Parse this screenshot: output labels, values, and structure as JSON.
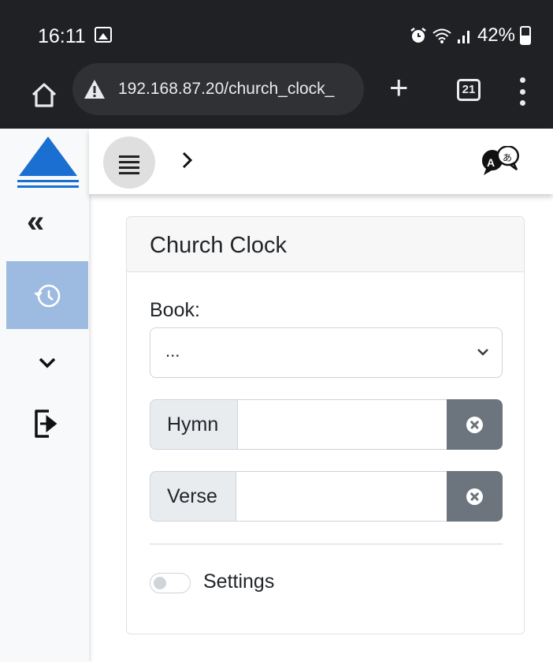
{
  "status_bar": {
    "time": "16:11",
    "battery": "42%",
    "icons": [
      "image-icon",
      "alarm-icon",
      "wifi-icon",
      "signal-icon",
      "battery-icon"
    ]
  },
  "browser": {
    "url": "192.168.87.20/church_clock_",
    "tab_count": "21",
    "icons": [
      "home-icon",
      "warning-icon",
      "plus-icon",
      "tabs-icon",
      "kebab-menu-icon"
    ]
  },
  "sidebar": {
    "collapse_glyph": "«",
    "icons": [
      "logo-triangle-icon",
      "double-chevron-left-icon",
      "history-icon",
      "chevron-down-icon",
      "exit-icon"
    ],
    "active_item": "history",
    "active_color": "#9dbbe0"
  },
  "appbar": {
    "icons": [
      "hamburger-icon",
      "chevron-right-icon",
      "translate-icon"
    ]
  },
  "card": {
    "title": "Church Clock",
    "book_label": "Book:",
    "book_value": "...",
    "hymn_label": "Hymn",
    "hymn_value": "",
    "verse_label": "Verse",
    "verse_value": "",
    "settings_label": "Settings",
    "settings_enabled": false
  },
  "colors": {
    "chrome": "#202124",
    "logo_blue": "#1a6fd1",
    "clear_button": "#6c757d"
  }
}
